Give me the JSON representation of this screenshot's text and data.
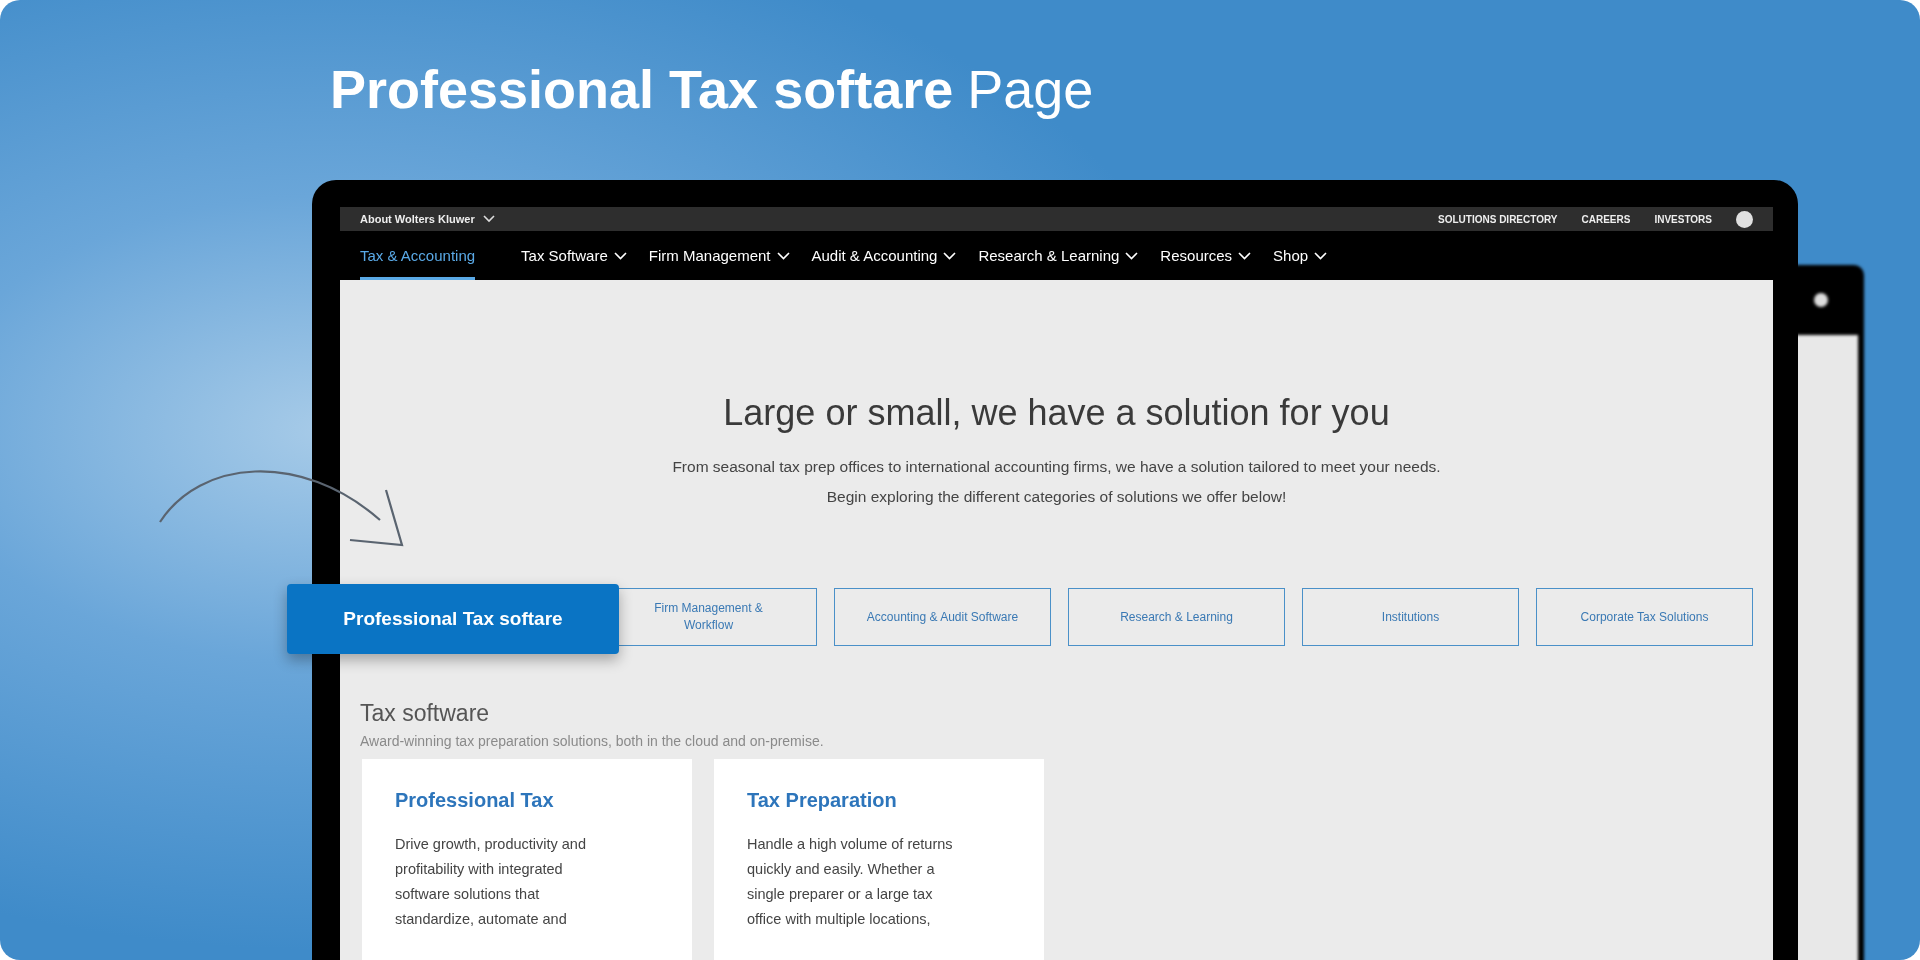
{
  "headline": {
    "bold": "Professional Tax softare",
    "regular": "Page"
  },
  "callout": {
    "label": "Professional Tax softare"
  },
  "utility_bar": {
    "menu": "About Wolters Kluwer",
    "links": [
      "SOLUTIONS DIRECTORY",
      "CAREERS",
      "INVESTORS"
    ]
  },
  "nav": [
    {
      "label": "Tax & Accounting",
      "selected": true,
      "dropdown": false
    },
    {
      "label": "Tax Software",
      "selected": false,
      "dropdown": true
    },
    {
      "label": "Firm Management",
      "selected": false,
      "dropdown": true
    },
    {
      "label": "Audit & Accounting",
      "selected": false,
      "dropdown": true
    },
    {
      "label": "Research & Learning",
      "selected": false,
      "dropdown": true
    },
    {
      "label": "Resources",
      "selected": false,
      "dropdown": true
    },
    {
      "label": "Shop",
      "selected": false,
      "dropdown": true
    }
  ],
  "hero": {
    "title": "Large or small, we have a solution for you",
    "lines": [
      "From seasonal tax prep offices to international accounting firms, we have a solution tailored to meet your needs.",
      "Begin exploring the different categories of solutions we offer below!"
    ]
  },
  "categories": [
    "Firm Management & Workflow",
    "Accounting & Audit Software",
    "Research & Learning",
    "Institutions",
    "Corporate Tax Solutions"
  ],
  "section": {
    "title": "Tax software",
    "subtitle": "Award-winning tax preparation solutions, both in the cloud and on-premise.",
    "cards": [
      {
        "title": "Professional Tax",
        "lines": [
          "Drive growth, productivity and",
          "profitability with integrated",
          "software solutions that",
          "standardize, automate and"
        ]
      },
      {
        "title": "Tax Preparation",
        "lines": [
          "Handle a high volume of returns",
          "quickly and easily. Whether a",
          "single preparer or a large tax",
          "office with multiple locations,"
        ]
      }
    ]
  }
}
